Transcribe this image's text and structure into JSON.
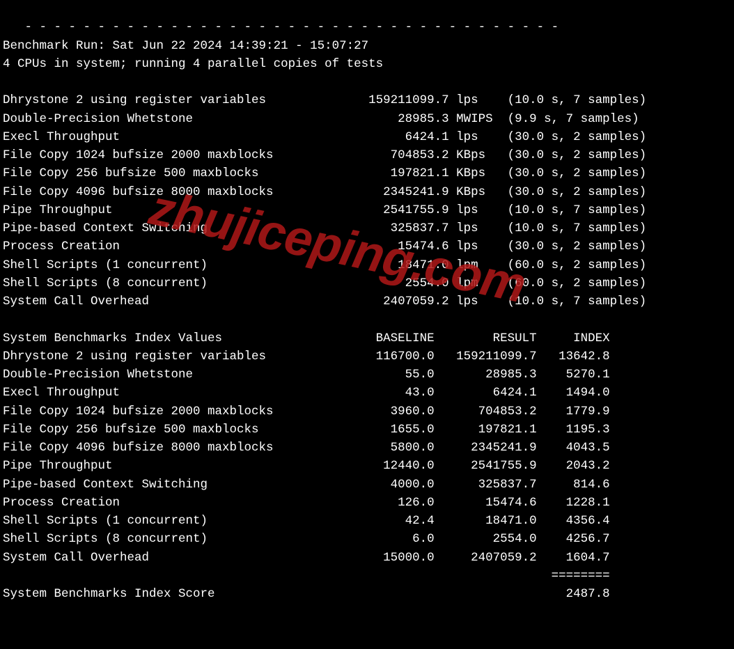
{
  "separator_line": "   - - - - - - - - - - - - - - - - - - - - - - - - - - - - - - - - - - - - -",
  "run_line": "Benchmark Run: Sat Jun 22 2024 14:39:21 - 15:07:27",
  "cpu_line": "4 CPUs in system; running 4 parallel copies of tests",
  "tests": [
    {
      "name": "Dhrystone 2 using register variables",
      "value": "159211099.7",
      "unit": "lps",
      "note": "(10.0 s, 7 samples)"
    },
    {
      "name": "Double-Precision Whetstone",
      "value": "28985.3",
      "unit": "MWIPS",
      "note": "(9.9 s, 7 samples)"
    },
    {
      "name": "Execl Throughput",
      "value": "6424.1",
      "unit": "lps",
      "note": "(30.0 s, 2 samples)"
    },
    {
      "name": "File Copy 1024 bufsize 2000 maxblocks",
      "value": "704853.2",
      "unit": "KBps",
      "note": "(30.0 s, 2 samples)"
    },
    {
      "name": "File Copy 256 bufsize 500 maxblocks",
      "value": "197821.1",
      "unit": "KBps",
      "note": "(30.0 s, 2 samples)"
    },
    {
      "name": "File Copy 4096 bufsize 8000 maxblocks",
      "value": "2345241.9",
      "unit": "KBps",
      "note": "(30.0 s, 2 samples)"
    },
    {
      "name": "Pipe Throughput",
      "value": "2541755.9",
      "unit": "lps",
      "note": "(10.0 s, 7 samples)"
    },
    {
      "name": "Pipe-based Context Switching",
      "value": "325837.7",
      "unit": "lps",
      "note": "(10.0 s, 7 samples)"
    },
    {
      "name": "Process Creation",
      "value": "15474.6",
      "unit": "lps",
      "note": "(30.0 s, 2 samples)"
    },
    {
      "name": "Shell Scripts (1 concurrent)",
      "value": "18471.0",
      "unit": "lpm",
      "note": "(60.0 s, 2 samples)"
    },
    {
      "name": "Shell Scripts (8 concurrent)",
      "value": "2554.0",
      "unit": "lpm",
      "note": "(60.0 s, 2 samples)"
    },
    {
      "name": "System Call Overhead",
      "value": "2407059.2",
      "unit": "lps",
      "note": "(10.0 s, 7 samples)"
    }
  ],
  "index_header": {
    "title": "System Benchmarks Index Values",
    "col_baseline": "BASELINE",
    "col_result": "RESULT",
    "col_index": "INDEX"
  },
  "index_rows": [
    {
      "name": "Dhrystone 2 using register variables",
      "baseline": "116700.0",
      "result": "159211099.7",
      "index": "13642.8"
    },
    {
      "name": "Double-Precision Whetstone",
      "baseline": "55.0",
      "result": "28985.3",
      "index": "5270.1"
    },
    {
      "name": "Execl Throughput",
      "baseline": "43.0",
      "result": "6424.1",
      "index": "1494.0"
    },
    {
      "name": "File Copy 1024 bufsize 2000 maxblocks",
      "baseline": "3960.0",
      "result": "704853.2",
      "index": "1779.9"
    },
    {
      "name": "File Copy 256 bufsize 500 maxblocks",
      "baseline": "1655.0",
      "result": "197821.1",
      "index": "1195.3"
    },
    {
      "name": "File Copy 4096 bufsize 8000 maxblocks",
      "baseline": "5800.0",
      "result": "2345241.9",
      "index": "4043.5"
    },
    {
      "name": "Pipe Throughput",
      "baseline": "12440.0",
      "result": "2541755.9",
      "index": "2043.2"
    },
    {
      "name": "Pipe-based Context Switching",
      "baseline": "4000.0",
      "result": "325837.7",
      "index": "814.6"
    },
    {
      "name": "Process Creation",
      "baseline": "126.0",
      "result": "15474.6",
      "index": "1228.1"
    },
    {
      "name": "Shell Scripts (1 concurrent)",
      "baseline": "42.4",
      "result": "18471.0",
      "index": "4356.4"
    },
    {
      "name": "Shell Scripts (8 concurrent)",
      "baseline": "6.0",
      "result": "2554.0",
      "index": "4256.7"
    },
    {
      "name": "System Call Overhead",
      "baseline": "15000.0",
      "result": "2407059.2",
      "index": "1604.7"
    }
  ],
  "score_underline": "========",
  "score_label": "System Benchmarks Index Score",
  "score_value": "2487.8",
  "watermark": "zhujiceping.com"
}
